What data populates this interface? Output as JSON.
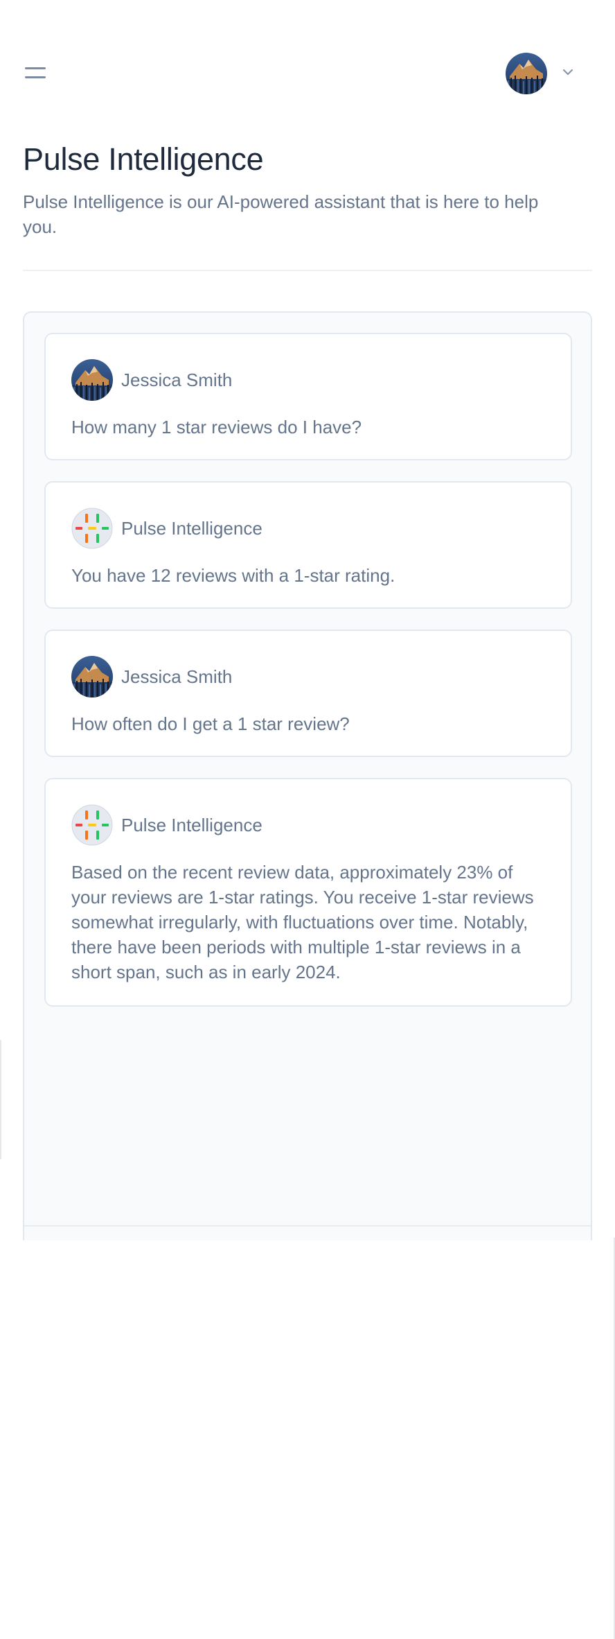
{
  "header": {
    "menu_icon": "hamburger-menu-icon",
    "user_avatar_icon": "user-avatar-mountain-photo",
    "dropdown_icon": "chevron-down-icon"
  },
  "page": {
    "title": "Pulse Intelligence",
    "description": "Pulse Intelligence is our AI-powered assistant that is here to help you."
  },
  "messages": [
    {
      "author": "Jessica Smith",
      "avatar": "user-avatar",
      "text": "How many 1 star reviews do I have?"
    },
    {
      "author": "Pulse Intelligence",
      "avatar": "pulse-logo",
      "text": "You have 12 reviews with a 1-star rating."
    },
    {
      "author": "Jessica Smith",
      "avatar": "user-avatar",
      "text": "How often do I get a 1 star review?"
    },
    {
      "author": "Pulse Intelligence",
      "avatar": "pulse-logo",
      "text": "Based on the recent review data, approximately 23% of your reviews are 1-star ratings. You receive 1-star reviews somewhat irregularly, with fluctuations over time. Notably, there have been periods with multiple 1-star reviews in a short span, such as in early 2024."
    }
  ],
  "colors": {
    "title": "#1f2a3c",
    "muted_text": "#64748b",
    "border": "#e2e8f0",
    "panel_bg": "#f8fafc",
    "logo_orange": "#f97316",
    "logo_yellow": "#facc15",
    "logo_green": "#22c55e",
    "logo_red": "#ef4444"
  }
}
